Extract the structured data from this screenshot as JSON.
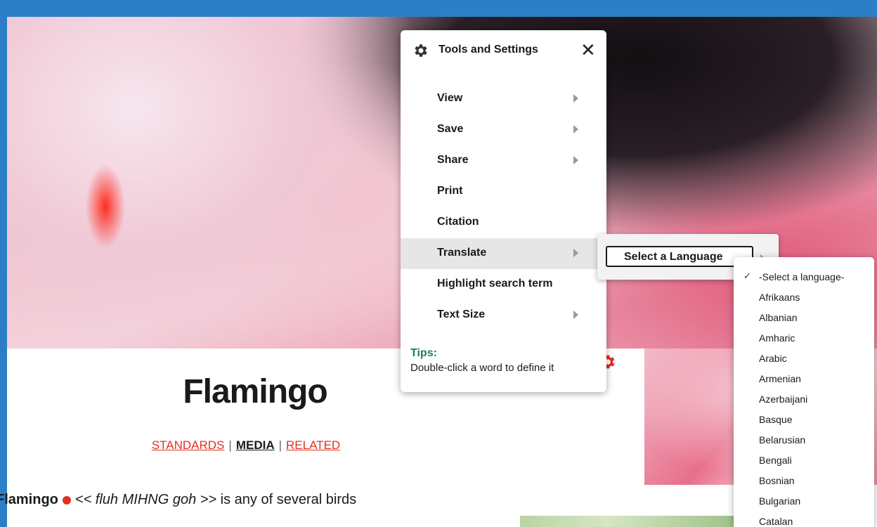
{
  "article": {
    "title": "Flamingo",
    "nav": {
      "standards": "STANDARDS",
      "media": "MEDIA",
      "related": "RELATED",
      "separator": "|"
    },
    "intro_bold": "Flamingo",
    "intro_pron": "<< fluh MIHNG goh >>",
    "intro_rest": " is any of several birds"
  },
  "tools": {
    "title": "Tools and Settings",
    "close": "✕",
    "items": [
      {
        "label": "View",
        "has_submenu": true
      },
      {
        "label": "Save",
        "has_submenu": true
      },
      {
        "label": "Share",
        "has_submenu": true
      },
      {
        "label": "Print",
        "has_submenu": false
      },
      {
        "label": "Citation",
        "has_submenu": false
      },
      {
        "label": "Translate",
        "has_submenu": true,
        "active": true
      },
      {
        "label": "Highlight search term",
        "has_submenu": false
      },
      {
        "label": "Text Size",
        "has_submenu": true
      }
    ],
    "tips_label": "Tips:",
    "tips_text": "Double-click a word to define it"
  },
  "translate": {
    "select_label": "Select a Language"
  },
  "languages": {
    "selected_index": 0,
    "check": "✓",
    "options": [
      "-Select a language-",
      "Afrikaans",
      "Albanian",
      "Amharic",
      "Arabic",
      "Armenian",
      "Azerbaijani",
      "Basque",
      "Belarusian",
      "Bengali",
      "Bosnian",
      "Bulgarian",
      "Catalan"
    ]
  },
  "colors": {
    "frame": "#2b7fc7",
    "accent_red": "#e0301e",
    "tips_green": "#1b7f5a",
    "active_row": "#e6e6e6"
  },
  "icons": {
    "tools_gear": "gear-icon",
    "orange_gear": "gear-icon",
    "close": "close-icon",
    "audio": "audio-icon"
  }
}
